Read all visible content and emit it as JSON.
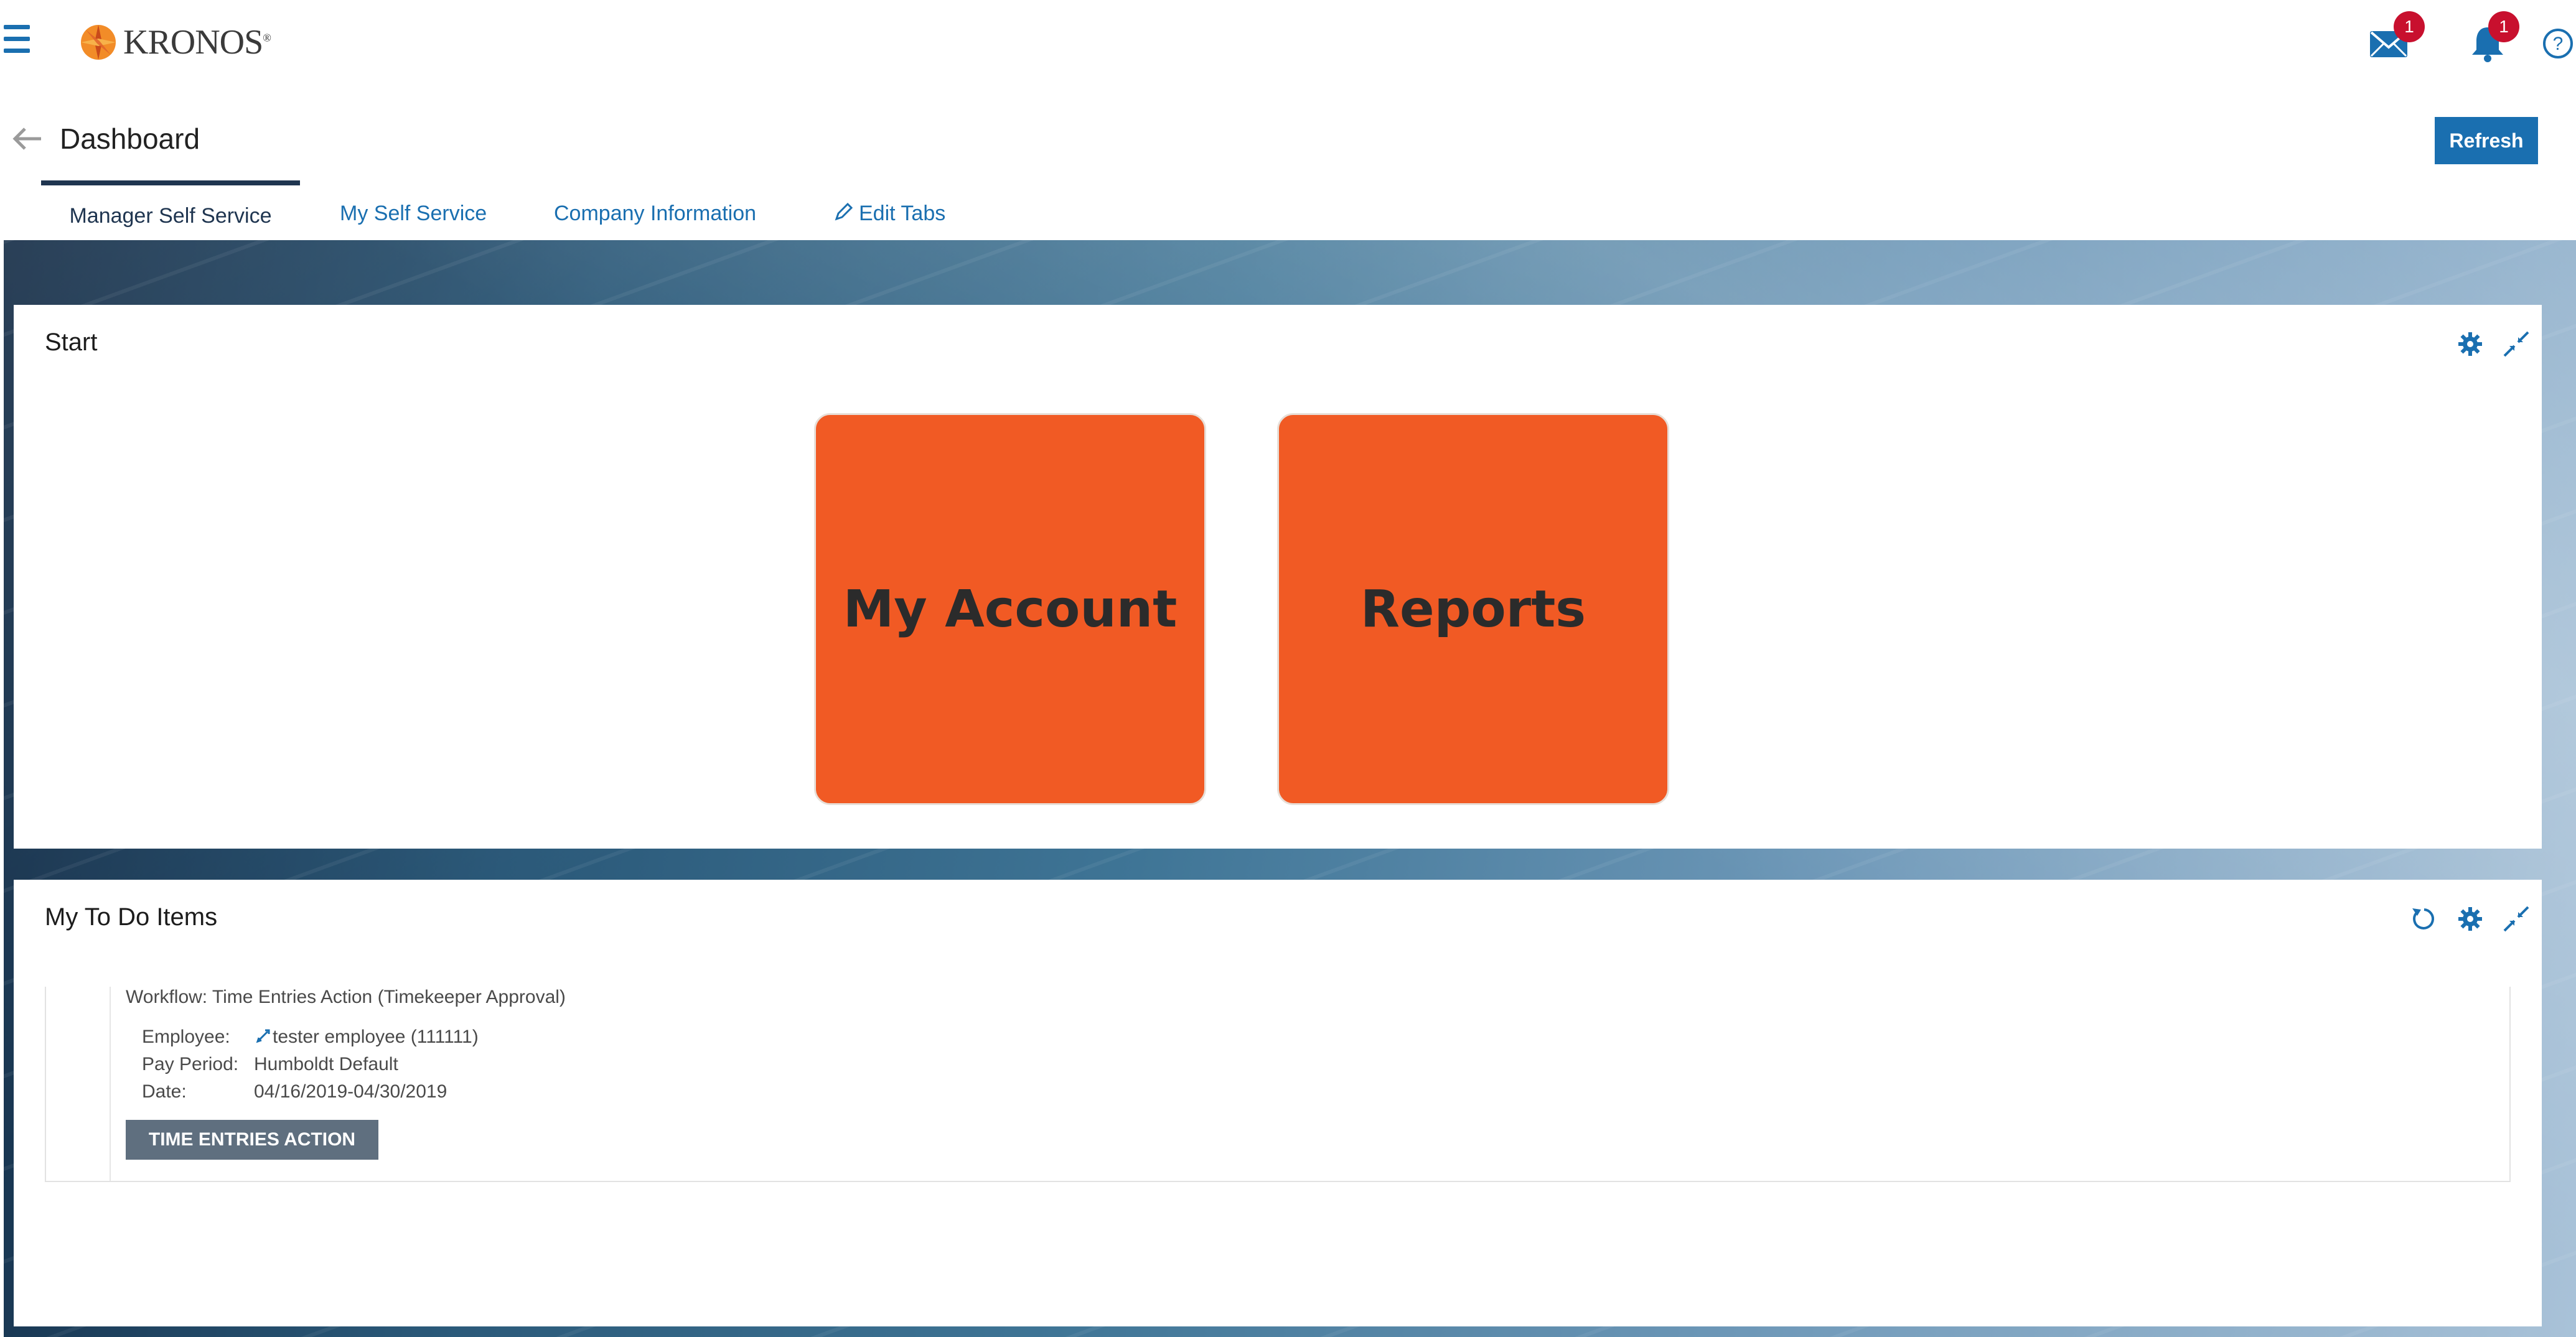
{
  "header": {
    "menu_icon": "hamburger-icon",
    "logo_text": "KRONOS",
    "logo_mark": "®",
    "mail_badge": "1",
    "bell_badge": "1",
    "colors": {
      "accent": "#1a6fb0",
      "badge": "#c8102e",
      "tile": "#f15a24"
    }
  },
  "page": {
    "title": "Dashboard",
    "refresh_label": "Refresh"
  },
  "tabs": [
    {
      "label": "Manager Self Service",
      "active": true
    },
    {
      "label": "My Self Service"
    },
    {
      "label": "Company Information"
    },
    {
      "label": "Edit Tabs",
      "icon": "pencil-icon"
    }
  ],
  "start_panel": {
    "title": "Start",
    "tiles": [
      {
        "label": "My Account"
      },
      {
        "label": "Reports"
      }
    ]
  },
  "todo_panel": {
    "title": "My To Do Items",
    "item": {
      "workflow": "Workflow: Time Entries Action (Timekeeper Approval)",
      "employee_label": "Employee:",
      "employee_value": "tester employee (111111)",
      "pay_period_label": "Pay Period:",
      "pay_period_value": "Humboldt Default",
      "date_label": "Date:",
      "date_value": "04/16/2019-04/30/2019",
      "action_label": "TIME ENTRIES ACTION"
    }
  }
}
